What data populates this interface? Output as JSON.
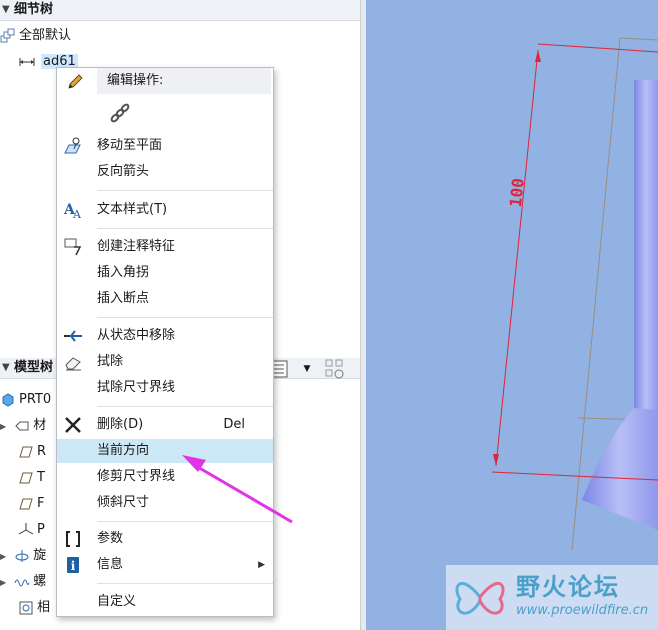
{
  "detail_tree": {
    "title": "细节树",
    "items": [
      {
        "label": "全部默认",
        "icon": "layers-icon"
      },
      {
        "label": "ad61",
        "icon": "dimension-icon",
        "selected": true
      }
    ]
  },
  "model_tree": {
    "title": "模型树",
    "items": [
      {
        "label": "PRT0",
        "icon": "part-cube-icon"
      },
      {
        "label": "材",
        "icon": "material-icon",
        "expand": "▶"
      },
      {
        "label": "R",
        "icon": "datum-plane-icon"
      },
      {
        "label": "T",
        "icon": "datum-plane-icon"
      },
      {
        "label": "F",
        "icon": "datum-plane-icon"
      },
      {
        "label": "P",
        "icon": "coordinate-system-icon"
      },
      {
        "label": "旋",
        "icon": "revolve-icon",
        "expand": "▶"
      },
      {
        "label": "螺",
        "icon": "helical-sweep-icon",
        "expand": "▶"
      },
      {
        "label": "相",
        "icon": "sketch-icon"
      }
    ]
  },
  "context_menu": {
    "header": "编辑操作:",
    "items": [
      {
        "label": "移动至平面",
        "icon": "move-to-plane-icon"
      },
      {
        "label": "反向箭头"
      },
      {
        "label": "文本样式(T)",
        "icon": "text-style-icon"
      },
      {
        "label": "创建注释特征",
        "icon": "annotation-feature-icon"
      },
      {
        "label": "插入角拐"
      },
      {
        "label": "插入断点"
      },
      {
        "label": "从状态中移除",
        "icon": "remove-from-state-icon"
      },
      {
        "label": "拭除",
        "icon": "eraser-icon"
      },
      {
        "label": "拭除尺寸界线"
      },
      {
        "label": "删除(D)",
        "shortcut": "Del",
        "icon": "delete-x-icon"
      },
      {
        "label": "当前方向"
      },
      {
        "label": "修剪尺寸界线"
      },
      {
        "label": "倾斜尺寸"
      },
      {
        "label": "参数",
        "icon": "parameters-brackets-icon"
      },
      {
        "label": "信息",
        "icon": "info-icon",
        "submenu": "▶"
      },
      {
        "label": "自定义"
      }
    ]
  },
  "viewport": {
    "dimension_value": "100",
    "background": "#91b2e2",
    "dimension_color": "#e0243a"
  },
  "watermark": {
    "title": "野火论坛",
    "url": "www.proewildfire.cn"
  },
  "colors": {
    "menu_hover": "#cce8f6",
    "selection": "#cde8ff",
    "arrow": "#e233e8"
  }
}
